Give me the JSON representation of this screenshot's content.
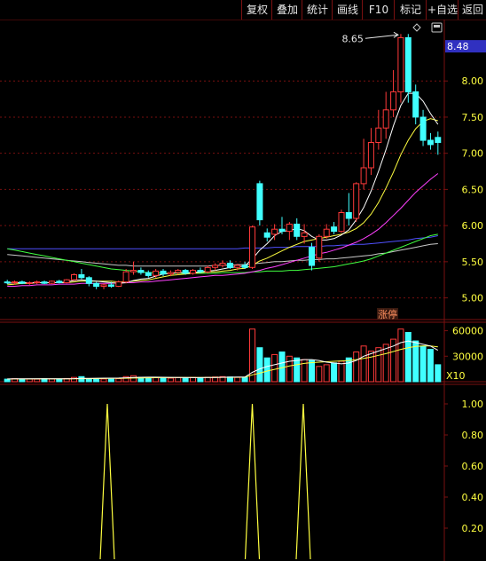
{
  "toolbar": {
    "buttons": [
      "复权",
      "叠加",
      "统计",
      "画线",
      "F10",
      "标记",
      "+自选",
      "返回"
    ]
  },
  "colors": {
    "background": "#000000",
    "grid": "#7a1010",
    "up": "#ff3a3a",
    "down": "#40ffff",
    "ma_white": "#ffffff",
    "ma_yellow": "#ffff40",
    "ma_magenta": "#ff40ff",
    "ma_green": "#40ff40",
    "ma_blue": "#5050ff",
    "ma_gray": "#c8c8c8",
    "last_price_box": "#3030c0",
    "axis_text": "#ffff40"
  },
  "price_panel": {
    "max_price_label": "8.65",
    "last_price_tag": "8.48",
    "y_ticks": [
      "8.00",
      "7.50",
      "7.00",
      "6.50",
      "6.00",
      "5.50",
      "5.00"
    ],
    "marker_text": "涨停"
  },
  "volume_panel": {
    "y_ticks": [
      "60000",
      "30000"
    ],
    "unit_label": "X10"
  },
  "indicator_panel": {
    "y_ticks": [
      "1.00",
      "0.80",
      "0.60",
      "0.40",
      "0.20"
    ]
  },
  "chart_data": [
    {
      "type": "candlestick",
      "ylim": [
        4.7,
        8.85
      ],
      "y_ticks": [
        8.0,
        7.5,
        7.0,
        6.5,
        6.0,
        5.5,
        5.0
      ],
      "candles": [
        {
          "o": 5.22,
          "h": 5.25,
          "l": 5.19,
          "c": 5.21
        },
        {
          "o": 5.21,
          "h": 5.24,
          "l": 5.18,
          "c": 5.22
        },
        {
          "o": 5.22,
          "h": 5.24,
          "l": 5.19,
          "c": 5.2
        },
        {
          "o": 5.2,
          "h": 5.23,
          "l": 5.18,
          "c": 5.21
        },
        {
          "o": 5.21,
          "h": 5.24,
          "l": 5.19,
          "c": 5.22
        },
        {
          "o": 5.22,
          "h": 5.24,
          "l": 5.19,
          "c": 5.2
        },
        {
          "o": 5.2,
          "h": 5.24,
          "l": 5.19,
          "c": 5.23
        },
        {
          "o": 5.23,
          "h": 5.25,
          "l": 5.2,
          "c": 5.21
        },
        {
          "o": 5.21,
          "h": 5.26,
          "l": 5.2,
          "c": 5.25
        },
        {
          "o": 5.25,
          "h": 5.34,
          "l": 5.24,
          "c": 5.32
        },
        {
          "o": 5.32,
          "h": 5.4,
          "l": 5.26,
          "c": 5.28
        },
        {
          "o": 5.28,
          "h": 5.3,
          "l": 5.16,
          "c": 5.2
        },
        {
          "o": 5.2,
          "h": 5.22,
          "l": 5.12,
          "c": 5.16
        },
        {
          "o": 5.16,
          "h": 5.2,
          "l": 5.12,
          "c": 5.18
        },
        {
          "o": 5.18,
          "h": 5.22,
          "l": 5.14,
          "c": 5.16
        },
        {
          "o": 5.16,
          "h": 5.24,
          "l": 5.15,
          "c": 5.22
        },
        {
          "o": 5.22,
          "h": 5.4,
          "l": 5.2,
          "c": 5.36
        },
        {
          "o": 5.36,
          "h": 5.5,
          "l": 5.32,
          "c": 5.38
        },
        {
          "o": 5.38,
          "h": 5.42,
          "l": 5.32,
          "c": 5.35
        },
        {
          "o": 5.35,
          "h": 5.38,
          "l": 5.28,
          "c": 5.31
        },
        {
          "o": 5.31,
          "h": 5.4,
          "l": 5.28,
          "c": 5.37
        },
        {
          "o": 5.37,
          "h": 5.4,
          "l": 5.3,
          "c": 5.33
        },
        {
          "o": 5.33,
          "h": 5.38,
          "l": 5.3,
          "c": 5.35
        },
        {
          "o": 5.35,
          "h": 5.4,
          "l": 5.32,
          "c": 5.38
        },
        {
          "o": 5.38,
          "h": 5.4,
          "l": 5.32,
          "c": 5.34
        },
        {
          "o": 5.34,
          "h": 5.4,
          "l": 5.32,
          "c": 5.38
        },
        {
          "o": 5.38,
          "h": 5.42,
          "l": 5.34,
          "c": 5.36
        },
        {
          "o": 5.36,
          "h": 5.45,
          "l": 5.34,
          "c": 5.42
        },
        {
          "o": 5.42,
          "h": 5.48,
          "l": 5.38,
          "c": 5.45
        },
        {
          "o": 5.45,
          "h": 5.52,
          "l": 5.42,
          "c": 5.48
        },
        {
          "o": 5.48,
          "h": 5.52,
          "l": 5.4,
          "c": 5.42
        },
        {
          "o": 5.42,
          "h": 5.47,
          "l": 5.38,
          "c": 5.45
        },
        {
          "o": 5.45,
          "h": 5.5,
          "l": 5.4,
          "c": 5.42
        },
        {
          "o": 5.42,
          "h": 6.0,
          "l": 5.4,
          "c": 5.98
        },
        {
          "o": 6.58,
          "h": 6.62,
          "l": 6.0,
          "c": 6.08
        },
        {
          "o": 5.9,
          "h": 5.96,
          "l": 5.78,
          "c": 5.84
        },
        {
          "o": 5.88,
          "h": 6.02,
          "l": 5.8,
          "c": 5.95
        },
        {
          "o": 5.95,
          "h": 6.12,
          "l": 5.88,
          "c": 5.92
        },
        {
          "o": 5.92,
          "h": 6.05,
          "l": 5.8,
          "c": 6.02
        },
        {
          "o": 6.02,
          "h": 6.1,
          "l": 5.8,
          "c": 5.85
        },
        {
          "o": 5.85,
          "h": 6.02,
          "l": 5.75,
          "c": 5.9
        },
        {
          "o": 5.7,
          "h": 5.76,
          "l": 5.38,
          "c": 5.45
        },
        {
          "o": 5.55,
          "h": 5.88,
          "l": 5.5,
          "c": 5.85
        },
        {
          "o": 5.85,
          "h": 6.02,
          "l": 5.82,
          "c": 5.95
        },
        {
          "o": 5.98,
          "h": 6.05,
          "l": 5.88,
          "c": 5.92
        },
        {
          "o": 5.92,
          "h": 6.22,
          "l": 5.9,
          "c": 6.18
        },
        {
          "o": 6.18,
          "h": 6.45,
          "l": 6.0,
          "c": 6.1
        },
        {
          "o": 6.1,
          "h": 6.6,
          "l": 6.05,
          "c": 6.58
        },
        {
          "o": 6.58,
          "h": 7.2,
          "l": 6.5,
          "c": 6.8
        },
        {
          "o": 6.8,
          "h": 7.35,
          "l": 6.7,
          "c": 7.15
        },
        {
          "o": 7.15,
          "h": 7.6,
          "l": 7.05,
          "c": 7.35
        },
        {
          "o": 7.35,
          "h": 7.85,
          "l": 7.2,
          "c": 7.6
        },
        {
          "o": 7.6,
          "h": 8.15,
          "l": 7.5,
          "c": 7.85
        },
        {
          "o": 7.85,
          "h": 8.65,
          "l": 7.7,
          "c": 8.6
        },
        {
          "o": 8.6,
          "h": 8.65,
          "l": 7.7,
          "c": 7.85
        },
        {
          "o": 7.85,
          "h": 7.95,
          "l": 7.4,
          "c": 7.5
        },
        {
          "o": 7.5,
          "h": 7.6,
          "l": 7.1,
          "c": 7.18
        },
        {
          "o": 7.18,
          "h": 7.28,
          "l": 7.05,
          "c": 7.12
        },
        {
          "o": 7.22,
          "h": 7.3,
          "l": 6.98,
          "c": 7.15
        }
      ],
      "ma_white": [
        5.2,
        5.21,
        5.21,
        5.21,
        5.21,
        5.21,
        5.21,
        5.21,
        5.22,
        5.24,
        5.25,
        5.24,
        5.23,
        5.22,
        5.21,
        5.2,
        5.21,
        5.24,
        5.26,
        5.27,
        5.3,
        5.33,
        5.34,
        5.35,
        5.35,
        5.35,
        5.36,
        5.37,
        5.38,
        5.4,
        5.42,
        5.43,
        5.44,
        5.54,
        5.66,
        5.75,
        5.86,
        5.92,
        5.93,
        5.96,
        5.93,
        5.85,
        5.8,
        5.8,
        5.82,
        5.87,
        5.94,
        6.08,
        6.25,
        6.48,
        6.75,
        7.05,
        7.38,
        7.66,
        7.83,
        7.83,
        7.72,
        7.55,
        7.4
      ],
      "ma_yellow": [
        5.18,
        5.19,
        5.2,
        5.2,
        5.21,
        5.21,
        5.21,
        5.21,
        5.21,
        5.22,
        5.23,
        5.23,
        5.23,
        5.23,
        5.23,
        5.22,
        5.22,
        5.23,
        5.24,
        5.25,
        5.27,
        5.29,
        5.31,
        5.32,
        5.33,
        5.34,
        5.35,
        5.36,
        5.36,
        5.37,
        5.38,
        5.4,
        5.41,
        5.45,
        5.51,
        5.55,
        5.6,
        5.65,
        5.7,
        5.74,
        5.78,
        5.8,
        5.82,
        5.84,
        5.86,
        5.88,
        5.91,
        5.96,
        6.04,
        6.16,
        6.32,
        6.52,
        6.74,
        6.98,
        7.18,
        7.34,
        7.44,
        7.48,
        7.45
      ],
      "ma_magenta": [
        5.16,
        5.16,
        5.17,
        5.17,
        5.18,
        5.18,
        5.18,
        5.19,
        5.19,
        5.19,
        5.2,
        5.2,
        5.2,
        5.2,
        5.2,
        5.21,
        5.21,
        5.21,
        5.22,
        5.22,
        5.23,
        5.24,
        5.25,
        5.26,
        5.27,
        5.28,
        5.29,
        5.3,
        5.31,
        5.31,
        5.32,
        5.33,
        5.34,
        5.36,
        5.38,
        5.41,
        5.43,
        5.46,
        5.49,
        5.52,
        5.55,
        5.58,
        5.61,
        5.63,
        5.66,
        5.69,
        5.73,
        5.77,
        5.82,
        5.88,
        5.95,
        6.04,
        6.14,
        6.24,
        6.35,
        6.46,
        6.55,
        6.64,
        6.72
      ],
      "ma_green": [
        5.68,
        5.66,
        5.64,
        5.62,
        5.6,
        5.58,
        5.56,
        5.54,
        5.52,
        5.5,
        5.48,
        5.46,
        5.44,
        5.42,
        5.4,
        5.39,
        5.38,
        5.37,
        5.36,
        5.35,
        5.35,
        5.34,
        5.34,
        5.34,
        5.34,
        5.34,
        5.34,
        5.34,
        5.34,
        5.35,
        5.35,
        5.35,
        5.35,
        5.36,
        5.36,
        5.37,
        5.37,
        5.37,
        5.38,
        5.38,
        5.39,
        5.4,
        5.41,
        5.42,
        5.43,
        5.45,
        5.47,
        5.49,
        5.51,
        5.54,
        5.58,
        5.62,
        5.66,
        5.7,
        5.74,
        5.78,
        5.82,
        5.86,
        5.88
      ],
      "ma_blue": [
        5.68,
        5.68,
        5.68,
        5.68,
        5.68,
        5.68,
        5.68,
        5.68,
        5.68,
        5.68,
        5.68,
        5.68,
        5.68,
        5.68,
        5.68,
        5.68,
        5.68,
        5.68,
        5.68,
        5.68,
        5.68,
        5.68,
        5.68,
        5.68,
        5.68,
        5.68,
        5.68,
        5.68,
        5.68,
        5.68,
        5.68,
        5.68,
        5.69,
        5.69,
        5.69,
        5.69,
        5.7,
        5.7,
        5.7,
        5.71,
        5.71,
        5.71,
        5.71,
        5.72,
        5.72,
        5.73,
        5.73,
        5.74,
        5.74,
        5.75,
        5.76,
        5.77,
        5.78,
        5.79,
        5.8,
        5.82,
        5.83,
        5.84,
        5.86
      ],
      "ma_gray": [
        5.6,
        5.59,
        5.58,
        5.57,
        5.56,
        5.55,
        5.54,
        5.53,
        5.52,
        5.51,
        5.5,
        5.49,
        5.48,
        5.47,
        5.46,
        5.45,
        5.45,
        5.44,
        5.44,
        5.44,
        5.44,
        5.44,
        5.44,
        5.44,
        5.44,
        5.44,
        5.44,
        5.44,
        5.45,
        5.45,
        5.45,
        5.46,
        5.46,
        5.47,
        5.48,
        5.49,
        5.5,
        5.5,
        5.51,
        5.52,
        5.52,
        5.53,
        5.53,
        5.54,
        5.54,
        5.55,
        5.56,
        5.57,
        5.58,
        5.59,
        5.61,
        5.62,
        5.64,
        5.66,
        5.68,
        5.7,
        5.72,
        5.74,
        5.75
      ]
    },
    {
      "type": "bar",
      "ylim": [
        0,
        70000
      ],
      "y_ticks": [
        60000,
        30000
      ],
      "values": [
        3000,
        3500,
        3000,
        3200,
        3000,
        3500,
        3200,
        3000,
        3800,
        5000,
        6000,
        3500,
        3000,
        3200,
        3000,
        3600,
        6000,
        7000,
        5000,
        4500,
        5200,
        4800,
        4200,
        4800,
        4500,
        5000,
        4800,
        5200,
        5500,
        6000,
        5500,
        5000,
        5000,
        62000,
        40000,
        28000,
        32000,
        35000,
        30000,
        28000,
        26000,
        25000,
        18000,
        20000,
        22000,
        24000,
        28000,
        35000,
        42000,
        36000,
        40000,
        44000,
        50000,
        62000,
        58000,
        48000,
        42000,
        38000,
        20000
      ],
      "ma_white": [
        3200,
        3300,
        3300,
        3300,
        3300,
        3300,
        3300,
        3300,
        3400,
        3600,
        3900,
        4000,
        4100,
        4200,
        4200,
        4300,
        4600,
        5000,
        5200,
        5300,
        5300,
        5200,
        5100,
        5000,
        4900,
        4800,
        4800,
        4900,
        5000,
        5200,
        5300,
        5400,
        5400,
        11000,
        15000,
        18000,
        20000,
        22000,
        24000,
        25000,
        26000,
        26000,
        25000,
        23000,
        22000,
        21000,
        22000,
        25000,
        30000,
        33000,
        36000,
        39000,
        42000,
        46000,
        48000,
        46000,
        44000,
        42000,
        37000
      ],
      "ma_yellow": [
        3100,
        3200,
        3200,
        3200,
        3300,
        3300,
        3300,
        3300,
        3300,
        3400,
        3500,
        3600,
        3700,
        3800,
        3900,
        4000,
        4100,
        4300,
        4500,
        4600,
        4700,
        4800,
        4800,
        4900,
        4900,
        4900,
        4900,
        5000,
        5000,
        5100,
        5100,
        5200,
        5200,
        8000,
        10000,
        12500,
        14500,
        16500,
        18500,
        20000,
        21500,
        22500,
        23000,
        23500,
        24000,
        24500,
        25000,
        26000,
        27500,
        29000,
        31000,
        33000,
        35500,
        38000,
        40000,
        41500,
        42000,
        42000,
        41000
      ]
    },
    {
      "type": "line",
      "ylim": [
        0,
        1.08
      ],
      "y_ticks": [
        1.0,
        0.8,
        0.6,
        0.4,
        0.2
      ],
      "values": [
        0,
        0,
        0,
        0,
        0,
        0,
        0,
        0,
        0,
        0,
        0,
        0,
        0,
        0,
        0,
        0,
        0,
        0,
        0,
        0,
        0,
        0,
        0,
        0,
        0,
        0,
        0,
        0,
        0,
        0,
        0,
        0,
        0,
        1,
        0,
        0,
        0,
        0,
        0,
        0,
        0,
        0,
        0,
        0,
        0,
        0,
        0,
        0,
        0,
        0,
        0,
        0,
        0,
        0,
        0,
        0,
        0,
        0,
        0
      ]
    }
  ]
}
